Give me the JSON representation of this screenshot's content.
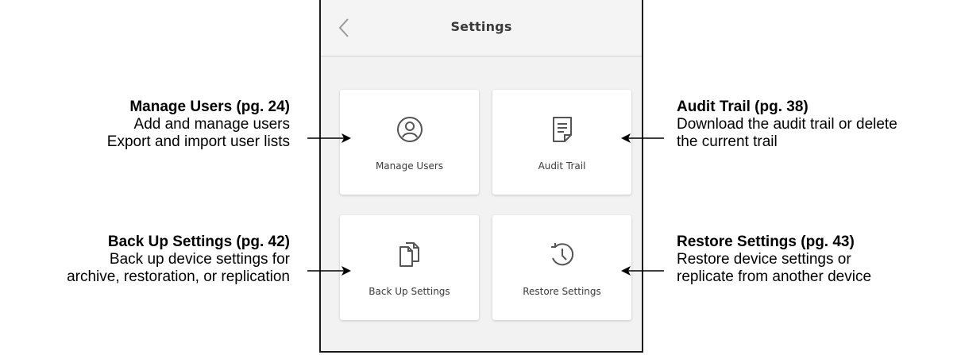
{
  "device": {
    "header_title": "Settings",
    "tiles": [
      {
        "label": "Manage Users",
        "icon": "user-circle-icon"
      },
      {
        "label": "Audit Trail",
        "icon": "document-icon"
      },
      {
        "label": "Back Up Settings",
        "icon": "copy-files-icon"
      },
      {
        "label": "Restore Settings",
        "icon": "history-icon"
      }
    ]
  },
  "annotations": {
    "manage_users": {
      "title": "Manage Users (pg.  24)",
      "lines": [
        "Add and manage users",
        "Export and import user lists"
      ]
    },
    "audit_trail": {
      "title": "Audit Trail (pg.  38)",
      "lines": [
        "Download the audit trail or delete",
        "the current trail"
      ]
    },
    "back_up_settings": {
      "title": "Back Up Settings (pg.  42)",
      "lines": [
        "Back up device settings for",
        "archive, restoration, or replication"
      ]
    },
    "restore_settings": {
      "title": "Restore Settings (pg.  43)",
      "lines": [
        "Restore device settings or",
        "replicate from another device"
      ]
    }
  },
  "colors": {
    "screen_bg": "#f2f2f2",
    "tile_bg": "#ffffff",
    "text_dark": "#3a3a3a",
    "border": "#1c1c1c"
  }
}
